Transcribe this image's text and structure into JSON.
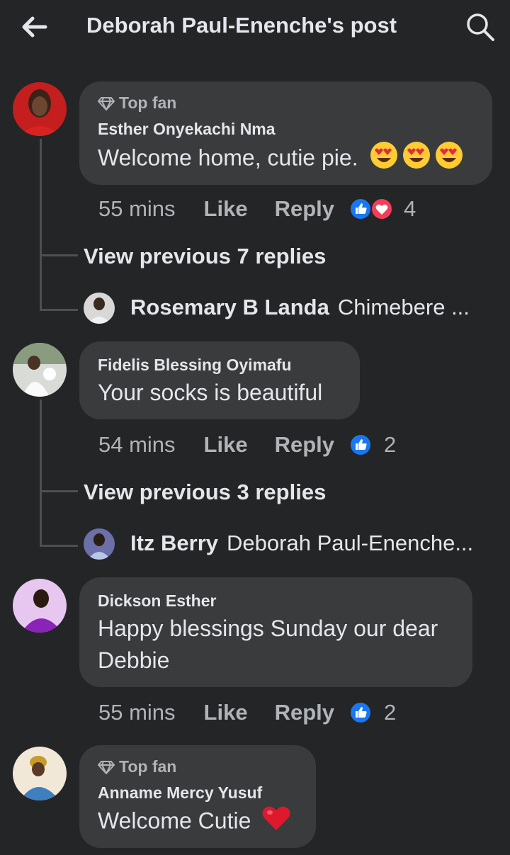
{
  "header": {
    "title": "Deborah Paul-Enenche's post",
    "back_icon": "arrow-left-icon",
    "search_icon": "search-icon"
  },
  "colors": {
    "background": "#242526",
    "bubble": "#3a3b3c",
    "text_primary": "#e4e6eb",
    "text_secondary": "#b0b3b8",
    "like_blue": "#1877f2",
    "love_red": "#f33e58"
  },
  "comments": [
    {
      "badge": "Top fan",
      "author": "Esther Onyekachi Nma",
      "text": "Welcome home, cutie pie.",
      "emoji": "heart-eyes-emoji x3",
      "time": "55 mins",
      "like": "Like",
      "reply": "Reply",
      "reactions": [
        "like",
        "love"
      ],
      "reaction_count": "4",
      "view_previous": "View previous 7 replies",
      "last_reply": {
        "name": "Rosemary B Landa",
        "text": "Chimebere ..."
      }
    },
    {
      "badge": "",
      "author": "Fidelis Blessing Oyimafu",
      "text": "Your socks is beautiful",
      "time": "54 mins",
      "like": "Like",
      "reply": "Reply",
      "reactions": [
        "like"
      ],
      "reaction_count": "2",
      "view_previous": "View previous 3 replies",
      "last_reply": {
        "name": "Itz Berry",
        "text": "Deborah Paul-Enenche..."
      }
    },
    {
      "badge": "",
      "author": "Dickson Esther",
      "text_line1": "Happy blessings Sunday our dear",
      "text_line2": "Debbie",
      "time": "55 mins",
      "like": "Like",
      "reply": "Reply",
      "reactions": [
        "like"
      ],
      "reaction_count": "2"
    },
    {
      "badge": "Top fan",
      "author": "Anname Mercy Yusuf",
      "text": "Welcome Cutie",
      "emoji": "red-heart-emoji"
    }
  ]
}
